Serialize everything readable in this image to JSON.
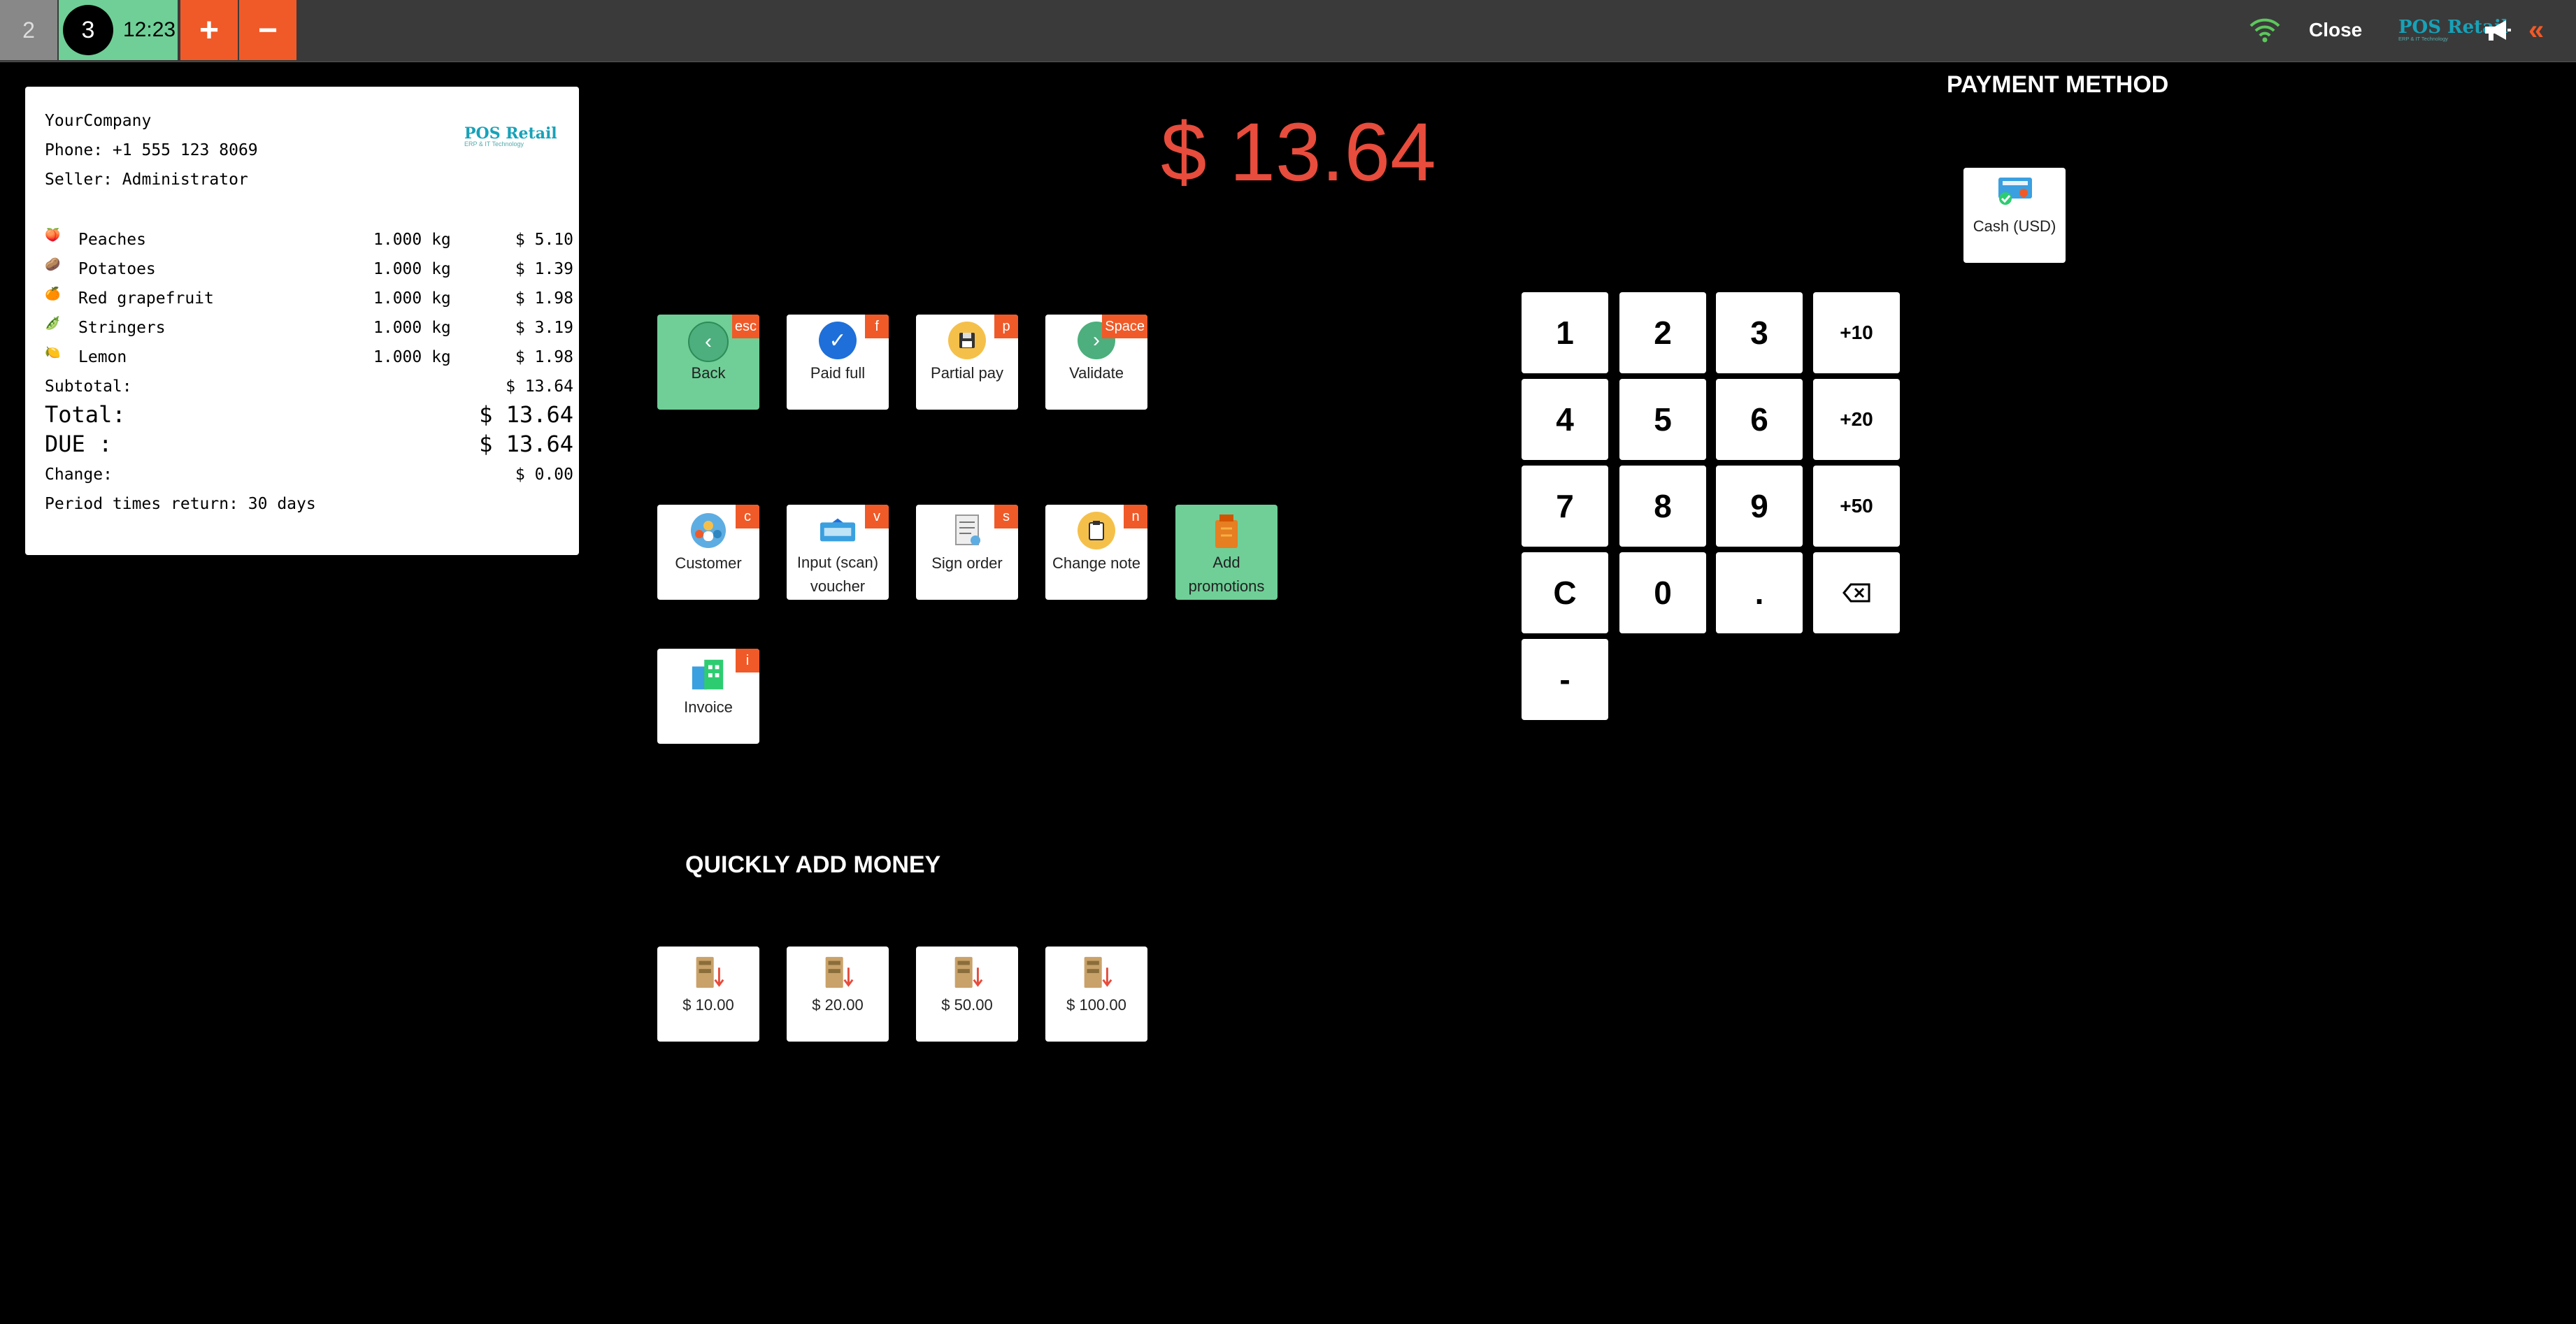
{
  "topbar": {
    "orders": [
      {
        "number": "2"
      },
      {
        "number": "3",
        "time": "12:23"
      }
    ],
    "add_label": "+",
    "remove_label": "−",
    "close_label": "Close",
    "logo_name": "POS Retail",
    "logo_tagline": "ERP & IT Technology"
  },
  "receipt": {
    "company": "YourCompany",
    "phone": "Phone: +1 555 123 8069",
    "seller": "Seller: Administrator",
    "logo_name": "POS Retail",
    "logo_tagline": "ERP & IT Technology",
    "items": [
      {
        "icon": "peach-icon",
        "glyph": "🍑",
        "name": "Peaches",
        "qty": "1.000 kg",
        "price": "$ 5.10"
      },
      {
        "icon": "potato-icon",
        "glyph": "🥔",
        "name": "Potatoes",
        "qty": "1.000 kg",
        "price": "$ 1.39"
      },
      {
        "icon": "grapefruit-icon",
        "glyph": "🍊",
        "name": "Red grapefruit",
        "qty": "1.000 kg",
        "price": "$ 1.98"
      },
      {
        "icon": "beans-icon",
        "glyph": "🫛",
        "name": "Stringers",
        "qty": "1.000 kg",
        "price": "$ 3.19"
      },
      {
        "icon": "lemon-icon",
        "glyph": "🍋",
        "name": "Lemon",
        "qty": "1.000 kg",
        "price": "$ 1.98"
      }
    ],
    "subtotal_label": "Subtotal:",
    "subtotal": "$ 13.64",
    "total_label": "Total:",
    "total": "$ 13.64",
    "due_label": "DUE :",
    "due": "$ 13.64",
    "change_label": "Change:",
    "change": "$ 0.00",
    "return_policy": "Period times return: 30 days"
  },
  "amount_due": "$ 13.64",
  "payment_method": {
    "title": "PAYMENT METHOD",
    "methods": [
      {
        "label": "Cash (USD)",
        "icon": "cash-register-icon"
      }
    ]
  },
  "actions": [
    {
      "label": "Back",
      "shortcut": "esc",
      "icon": "back-icon",
      "color": "#4caf7d"
    },
    {
      "label": "Paid full",
      "shortcut": "f",
      "icon": "check-icon",
      "color": "#1e6fd9"
    },
    {
      "label": "Partial pay",
      "shortcut": "p",
      "icon": "save-icon",
      "color": "#f5c04a"
    },
    {
      "label": "Validate",
      "shortcut": "Space",
      "icon": "next-icon",
      "color": "#4caf7d"
    },
    {
      "label": "Customer",
      "shortcut": "c",
      "icon": "customer-icon"
    },
    {
      "label": "Input (scan) voucher",
      "shortcut": "v",
      "icon": "voucher-icon"
    },
    {
      "label": "Sign order",
      "shortcut": "s",
      "icon": "sign-icon"
    },
    {
      "label": "Change note",
      "shortcut": "n",
      "icon": "note-icon"
    },
    {
      "label": "Add promotions",
      "icon": "promotion-icon"
    },
    {
      "label": "Invoice",
      "shortcut": "i",
      "icon": "invoice-icon"
    }
  ],
  "numpad": {
    "keys": [
      "1",
      "2",
      "3",
      "+10",
      "4",
      "5",
      "6",
      "+20",
      "7",
      "8",
      "9",
      "+50",
      "C",
      "0",
      ".",
      "⌫",
      "-"
    ]
  },
  "quick_money": {
    "title": "QUICKLY ADD MONEY",
    "amounts": [
      "$ 10.00",
      "$ 20.00",
      "$ 50.00",
      "$ 100.00"
    ]
  }
}
